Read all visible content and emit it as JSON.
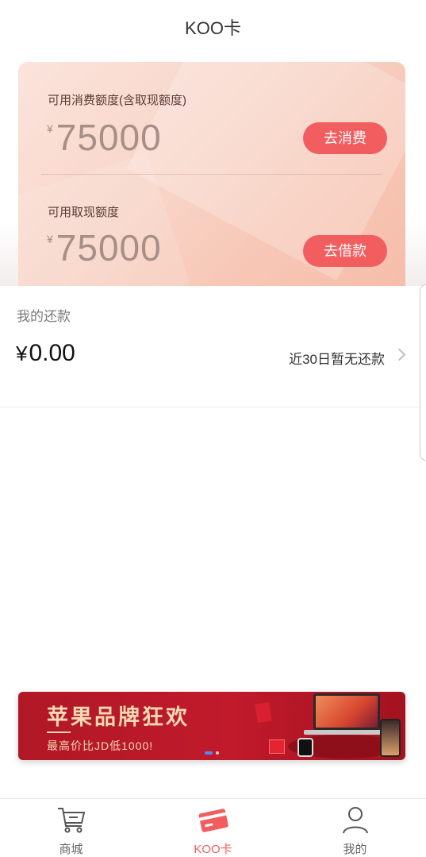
{
  "header": {
    "title": "KOO卡"
  },
  "card": {
    "consume": {
      "label": "可用消费额度(含取现额度)",
      "currency": "¥",
      "amount": "75000",
      "button": "去消费"
    },
    "cash": {
      "label": "可用取现额度",
      "currency": "¥",
      "amount": "75000",
      "button": "去借款"
    }
  },
  "repayment": {
    "title": "我的还款",
    "currency": "¥",
    "amount": "0.00",
    "status": "近30日暂无还款"
  },
  "banner": {
    "title": "苹果品牌狂欢",
    "subtitle": "最高价比JD低1000!",
    "pagination": {
      "current": 1,
      "total": 2
    }
  },
  "tabbar": {
    "tabs": [
      {
        "label": "商城",
        "icon": "cart-icon",
        "active": false
      },
      {
        "label": "KOO卡",
        "icon": "card-icon",
        "active": true
      },
      {
        "label": "我的",
        "icon": "user-icon",
        "active": false
      }
    ]
  },
  "colors": {
    "accent": "#f25d5f",
    "amount_text": "#a78f88",
    "banner_bg": "#b11826",
    "pagination_active": "#4d8cf5"
  }
}
